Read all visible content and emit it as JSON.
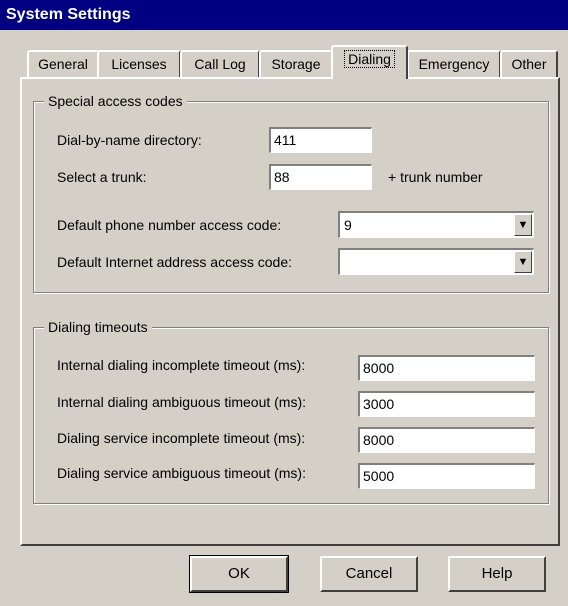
{
  "window": {
    "title": "System Settings"
  },
  "tabs": [
    {
      "label": "General"
    },
    {
      "label": "Licenses"
    },
    {
      "label": "Call Log"
    },
    {
      "label": "Storage"
    },
    {
      "label": "Dialing",
      "active": true
    },
    {
      "label": "Emergency"
    },
    {
      "label": "Other"
    }
  ],
  "special_access": {
    "title": "Special access codes",
    "dial_by_name": {
      "label": "Dial-by-name directory:",
      "value": "411"
    },
    "select_trunk": {
      "label": "Select a trunk:",
      "value": "88",
      "suffix": "+ trunk number"
    },
    "default_phone": {
      "label": "Default phone number access code:",
      "value": "9"
    },
    "default_internet": {
      "label": "Default Internet address access code:",
      "value": ""
    }
  },
  "timeouts": {
    "title": "Dialing timeouts",
    "internal_incomplete": {
      "label": "Internal dialing incomplete timeout (ms):",
      "value": "8000"
    },
    "internal_ambiguous": {
      "label": "Internal dialing ambiguous timeout (ms):",
      "value": "3000"
    },
    "service_incomplete": {
      "label": "Dialing service incomplete timeout (ms):",
      "value": "8000"
    },
    "service_ambiguous": {
      "label": "Dialing service ambiguous timeout (ms):",
      "value": "5000"
    }
  },
  "buttons": {
    "ok": "OK",
    "cancel": "Cancel",
    "help": "Help"
  },
  "icons": {
    "dropdown": "chevron-down-icon"
  }
}
